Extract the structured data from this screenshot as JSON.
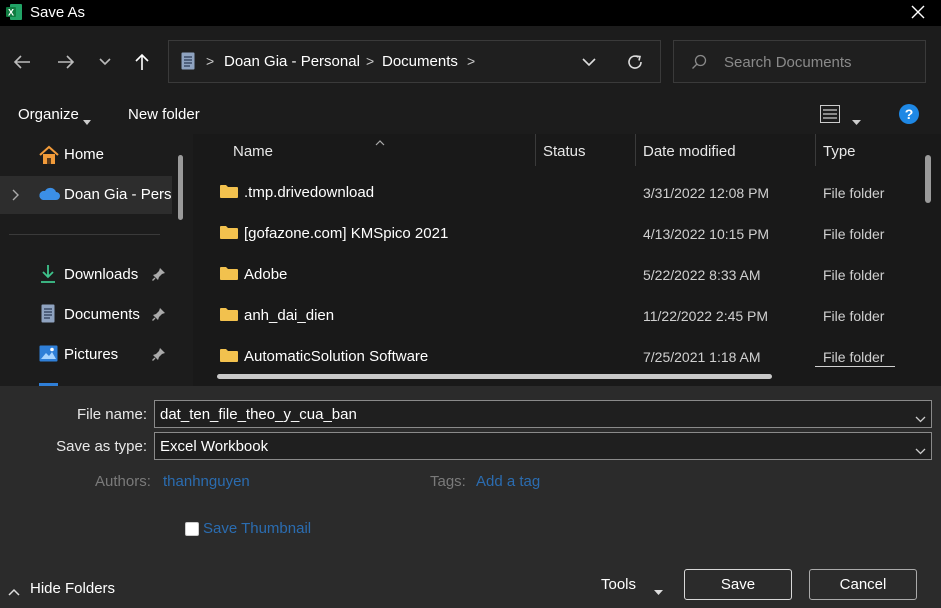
{
  "window": {
    "title": "Save As",
    "app_icon": "excel-icon"
  },
  "nav": {
    "breadcrumb": [
      "Doan Gia - Personal",
      "Documents"
    ],
    "search_placeholder": "Search Documents"
  },
  "toolbar": {
    "organize_label": "Organize",
    "new_folder_label": "New folder"
  },
  "sidebar": {
    "items": [
      {
        "label": "Home",
        "icon": "home-icon"
      },
      {
        "label": "Doan Gia - Perso",
        "icon": "cloud-icon"
      },
      {
        "label": "Downloads",
        "icon": "download-icon"
      },
      {
        "label": "Documents",
        "icon": "document-icon"
      },
      {
        "label": "Pictures",
        "icon": "picture-icon"
      }
    ]
  },
  "columns": {
    "name": "Name",
    "status": "Status",
    "date_modified": "Date modified",
    "type": "Type"
  },
  "files": [
    {
      "name": ".tmp.drivedownload",
      "date": "3/31/2022 12:08 PM",
      "type": "File folder"
    },
    {
      "name": "[gofazone.com] KMSpico 2021",
      "date": "4/13/2022 10:15 PM",
      "type": "File folder"
    },
    {
      "name": "Adobe",
      "date": "5/22/2022 8:33 AM",
      "type": "File folder"
    },
    {
      "name": "anh_dai_dien",
      "date": "11/22/2022 2:45 PM",
      "type": "File folder"
    },
    {
      "name": "AutomaticSolution Software",
      "date": "7/25/2021 1:18 AM",
      "type": "File folder"
    }
  ],
  "form": {
    "file_name_label": "File name:",
    "file_name_value": "dat_ten_file_theo_y_cua_ban",
    "save_type_label": "Save as type:",
    "save_type_value": "Excel Workbook",
    "authors_label": "Authors:",
    "authors_value": "thanhnguyen",
    "tags_label": "Tags:",
    "tags_value": "Add a tag",
    "thumbnail_label": "Save Thumbnail"
  },
  "footer": {
    "hide_folders_label": "Hide Folders",
    "tools_label": "Tools",
    "save_label": "Save",
    "cancel_label": "Cancel"
  },
  "colors": {
    "excel_green": "#1d6f42",
    "folder_yellow": "#f2c14e",
    "link_blue": "#2b6cb0",
    "help_blue": "#1e88e5",
    "onedrive_blue": "#3b8fe6"
  }
}
